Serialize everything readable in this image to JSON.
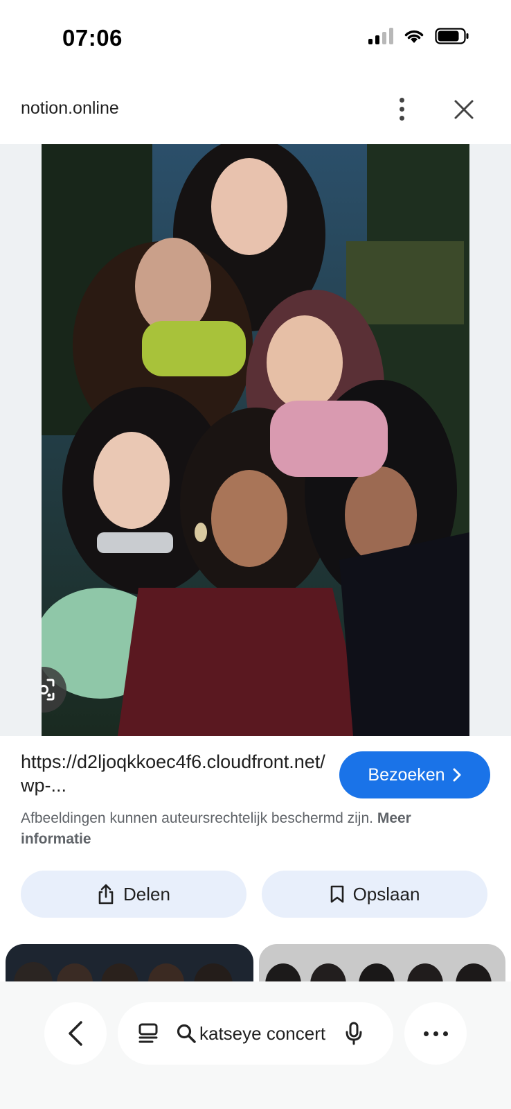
{
  "status_bar": {
    "time": "07:06",
    "icons": [
      "cellular-signal-icon",
      "wifi-icon",
      "battery-icon"
    ]
  },
  "header": {
    "site": "notion.online",
    "icons": [
      "more-vertical-icon",
      "close-icon"
    ]
  },
  "image": {
    "description_icon": "lens-search-icon"
  },
  "result": {
    "url": "https://d2ljoqkkoec4f6.cloudfront.net/wp-...",
    "visit_label": "Bezoeken",
    "copyright_text": "Afbeeldingen kunnen auteursrechtelijk beschermd zijn.",
    "copyright_link": "Meer informatie"
  },
  "actions": {
    "share_label": "Delen",
    "save_label": "Opslaan"
  },
  "search": {
    "query": "katseye concert"
  },
  "colors": {
    "accent": "#1a73e8",
    "pill_background": "#e8effb",
    "secondary_text": "#5f6368"
  }
}
